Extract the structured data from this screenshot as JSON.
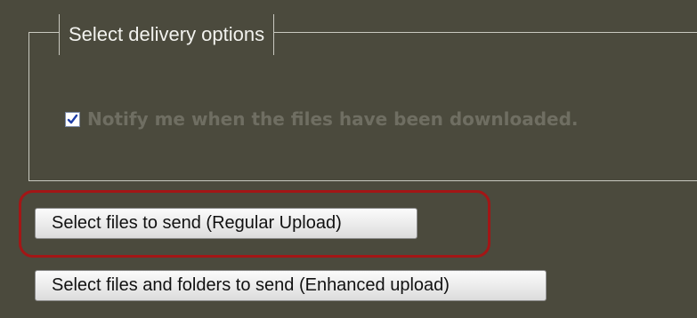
{
  "delivery_options": {
    "legend": "Select delivery options",
    "notify_checkbox_checked": true,
    "notify_label": "Notify me when the files have been downloaded."
  },
  "buttons": {
    "regular_upload_label": "Select files to send (Regular Upload)",
    "enhanced_upload_label": "Select files and folders to send (Enhanced upload)"
  },
  "colors": {
    "background": "#4b4a3d",
    "highlight": "#a31616",
    "checkmark": "#1f3fa8"
  }
}
